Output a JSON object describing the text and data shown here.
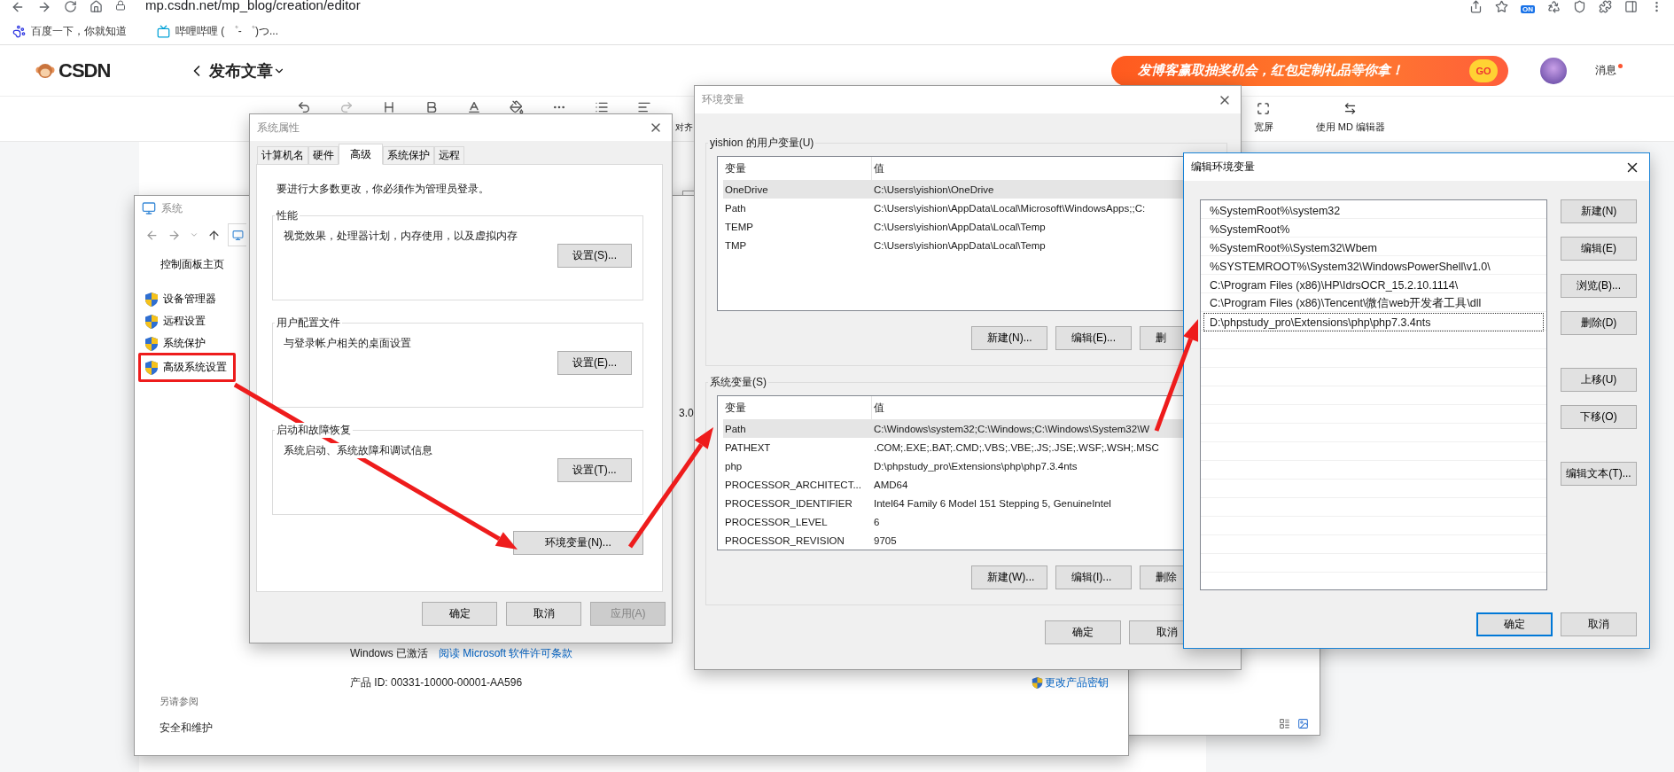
{
  "browser": {
    "url": "mp.csdn.net/mp_blog/creation/editor",
    "extension_badge": "ON",
    "bookmarks": [
      "百度一下，你就知道",
      "哔哩哔哩 ( ゜- ゜)つ..."
    ]
  },
  "header": {
    "logo": "CSDN",
    "title": "发布文章",
    "banner": "发博客赢取抽奖机会，红包定制礼品等你拿！",
    "banner_button": "GO",
    "messages": "消息",
    "unread": true
  },
  "toolbar": {
    "partial_label": "对齐",
    "items": [
      "宽屏",
      "使用 MD 编辑器"
    ]
  },
  "system_window": {
    "title": "系统",
    "home_link": "控制面板主页",
    "links": [
      {
        "label": "设备管理器",
        "highlighted": false
      },
      {
        "label": "远程设置",
        "highlighted": false
      },
      {
        "label": "系统保护",
        "highlighted": false
      },
      {
        "label": "高级系统设置",
        "highlighted": true
      }
    ],
    "partial_value": "3.0",
    "activation": "Windows 已激活",
    "license_link": "阅读 Microsoft 软件许可条款",
    "product_id": "产品 ID: 00331-10000-00001-AA596",
    "change_key_link": "更改产品密钥",
    "see_also_title": "另请参阅",
    "see_also": [
      "安全和维护"
    ]
  },
  "system_properties": {
    "title": "系统属性",
    "tabs": [
      {
        "label": "计算机名",
        "selected": false
      },
      {
        "label": "硬件",
        "selected": false
      },
      {
        "label": "高级",
        "selected": true
      },
      {
        "label": "系统保护",
        "selected": false
      },
      {
        "label": "远程",
        "selected": false
      }
    ],
    "notice": "要进行大多数更改，你必须作为管理员登录。",
    "groups": [
      {
        "title": "性能",
        "description": "视觉效果，处理器计划，内存使用，以及虚拟内存",
        "button": "设置(S)..."
      },
      {
        "title": "用户配置文件",
        "description": "与登录帐户相关的桌面设置",
        "button": "设置(E)..."
      },
      {
        "title": "启动和故障恢复",
        "description": "系统启动、系统故障和调试信息",
        "button": "设置(T)..."
      }
    ],
    "env_button": "环境变量(N)...",
    "buttons": [
      {
        "label": "确定",
        "disabled": false
      },
      {
        "label": "取消",
        "disabled": false
      },
      {
        "label": "应用(A)",
        "disabled": true
      }
    ]
  },
  "env_window": {
    "title": "环境变量",
    "sections": [
      {
        "title": "yishion 的用户变量(U)",
        "columns": [
          "变量",
          "值"
        ],
        "rows": [
          {
            "name": "OneDrive",
            "value": "C:\\Users\\yishion\\OneDrive",
            "selected": true
          },
          {
            "name": "Path",
            "value": "C:\\Users\\yishion\\AppData\\Local\\Microsoft\\WindowsApps;;C:",
            "selected": false
          },
          {
            "name": "TEMP",
            "value": "C:\\Users\\yishion\\AppData\\Local\\Temp",
            "selected": false
          },
          {
            "name": "TMP",
            "value": "C:\\Users\\yishion\\AppData\\Local\\Temp",
            "selected": false
          }
        ],
        "buttons": [
          "新建(N)...",
          "编辑(E)...",
          "删"
        ]
      },
      {
        "title": "系统变量(S)",
        "columns": [
          "变量",
          "值"
        ],
        "rows": [
          {
            "name": "Path",
            "value": "C:\\Windows\\system32;C:\\Windows;C:\\Windows\\System32\\W",
            "selected": true
          },
          {
            "name": "PATHEXT",
            "value": ".COM;.EXE;.BAT;.CMD;.VBS;.VBE;.JS;.JSE;.WSF;.WSH;.MSC",
            "selected": false
          },
          {
            "name": "php",
            "value": "D:\\phpstudy_pro\\Extensions\\php\\php7.3.4nts",
            "selected": false
          },
          {
            "name": "PROCESSOR_ARCHITECT...",
            "value": "AMD64",
            "selected": false
          },
          {
            "name": "PROCESSOR_IDENTIFIER",
            "value": "Intel64 Family 6 Model 151 Stepping 5, GenuineIntel",
            "selected": false
          },
          {
            "name": "PROCESSOR_LEVEL",
            "value": "6",
            "selected": false
          },
          {
            "name": "PROCESSOR_REVISION",
            "value": "9705",
            "selected": false
          }
        ],
        "buttons": [
          "新建(W)...",
          "编辑(I)...",
          "删除"
        ]
      }
    ],
    "buttons": [
      "确定",
      "取消"
    ]
  },
  "edit_window": {
    "title": "编辑环境变量",
    "entries": [
      {
        "value": "%SystemRoot%\\system32",
        "selected": false
      },
      {
        "value": "%SystemRoot%",
        "selected": false
      },
      {
        "value": "%SystemRoot%\\System32\\Wbem",
        "selected": false
      },
      {
        "value": "%SYSTEMROOT%\\System32\\WindowsPowerShell\\v1.0\\",
        "selected": false
      },
      {
        "value": "C:\\Program Files (x86)\\HP\\IdrsOCR_15.2.10.1114\\",
        "selected": false
      },
      {
        "value": "C:\\Program Files (x86)\\Tencent\\微信web开发者工具\\dll",
        "selected": false
      },
      {
        "value": "D:\\phpstudy_pro\\Extensions\\php\\php7.3.4nts",
        "selected": true
      }
    ],
    "button_groups": [
      [
        "新建(N)",
        "编辑(E)",
        "浏览(B)...",
        "删除(D)"
      ],
      [
        "上移(U)",
        "下移(O)"
      ],
      [
        "编辑文本(T)..."
      ]
    ],
    "footer": [
      {
        "label": "确定",
        "default": true
      },
      {
        "label": "取消",
        "default": false
      }
    ]
  }
}
